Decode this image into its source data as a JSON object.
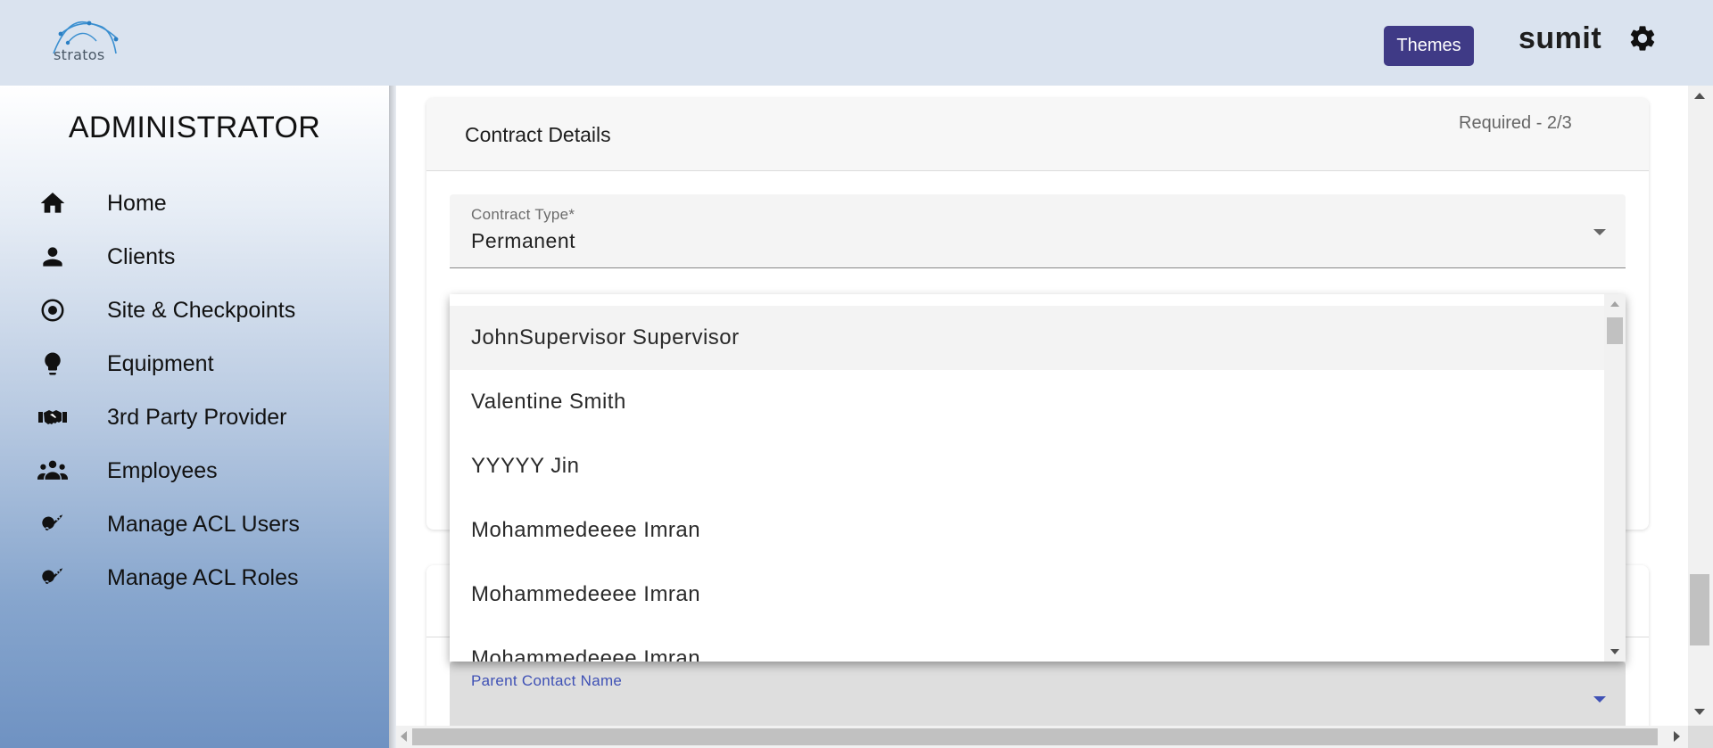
{
  "header": {
    "logo_text": "stratos",
    "themes_label": "Themes",
    "username": "sumit",
    "accent_color": "#3f3a86"
  },
  "sidebar": {
    "title": "ADMINISTRATOR",
    "items": [
      {
        "label": "Home",
        "icon": "home-icon"
      },
      {
        "label": "Clients",
        "icon": "person-icon"
      },
      {
        "label": "Site & Checkpoints",
        "icon": "target-icon"
      },
      {
        "label": "Equipment",
        "icon": "lightbulb-icon"
      },
      {
        "label": "3rd Party Provider",
        "icon": "handshake-icon"
      },
      {
        "label": "Employees",
        "icon": "group-icon"
      },
      {
        "label": "Manage ACL Users",
        "icon": "key-icon"
      },
      {
        "label": "Manage ACL Roles",
        "icon": "key-icon"
      }
    ]
  },
  "contract": {
    "title": "Contract Details",
    "required": "Required - 2/3",
    "contract_type_label": "Contract Type*",
    "contract_type_value": "Permanent"
  },
  "dropdown": {
    "options": [
      "JohnSupervisor Supervisor",
      "Valentine Smith",
      "YYYYY Jin",
      "Mohammedeeee Imran",
      "Mohammedeeee Imran",
      "Mohammedeeee Imran"
    ]
  },
  "parent_contact": {
    "label": "Parent Contact Name",
    "color": "#3f51b5"
  }
}
